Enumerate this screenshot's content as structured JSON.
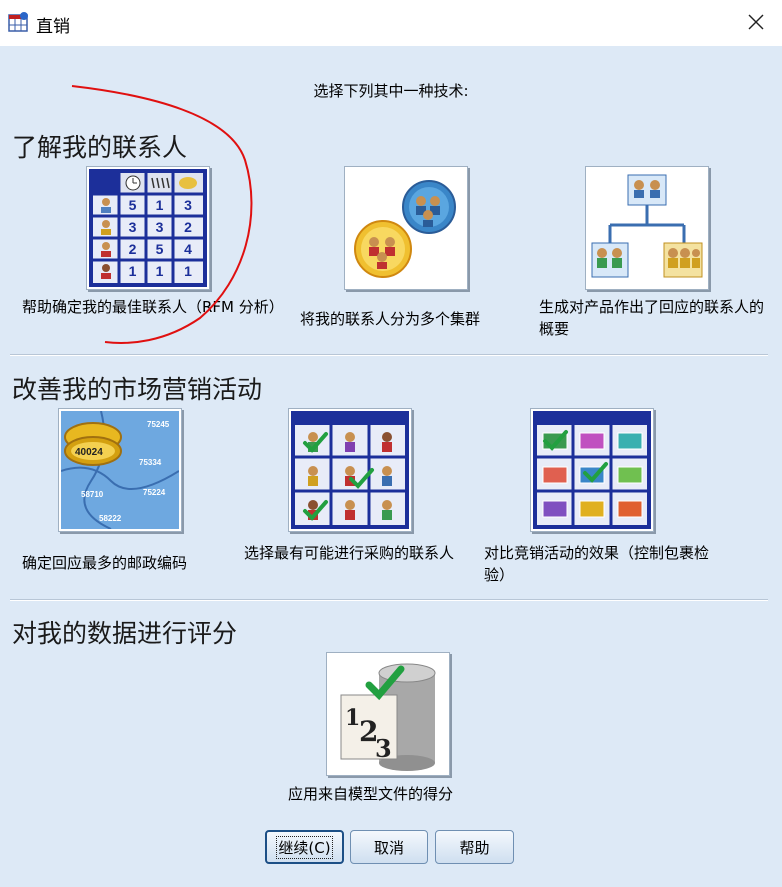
{
  "window": {
    "title": "直销",
    "app_icon": "spss-grid-icon",
    "close_icon": "close-icon"
  },
  "prompt": "选择下列其中一种技术:",
  "sections": [
    {
      "title": "了解我的联系人",
      "options": [
        {
          "label": "帮助确定我的最佳联系人（RFM 分析）",
          "icon": "rfm-table-icon",
          "table": [
            [
              "5",
              "1",
              "3"
            ],
            [
              "3",
              "3",
              "2"
            ],
            [
              "2",
              "5",
              "4"
            ],
            [
              "1",
              "1",
              "1"
            ]
          ]
        },
        {
          "label": "将我的联系人分为多个集群",
          "icon": "contact-clusters-icon"
        },
        {
          "label": "生成对产品作出了回应的联系人的概要",
          "icon": "contact-hierarchy-icon"
        }
      ]
    },
    {
      "title": "改善我的市场营销活动",
      "options": [
        {
          "label": "确定回应最多的邮政编码",
          "icon": "postal-code-map-icon",
          "codes": [
            "75245",
            "40024",
            "75334",
            "58710",
            "75224",
            "58222"
          ]
        },
        {
          "label": "选择最有可能进行采购的联系人",
          "icon": "select-contacts-grid-icon"
        },
        {
          "label": "对比竞销活动的效果（控制包裹检验）",
          "icon": "campaign-envelopes-icon"
        }
      ]
    },
    {
      "title": "对我的数据进行评分",
      "options": [
        {
          "label": "应用来自模型文件的得分",
          "icon": "score-model-icon"
        }
      ]
    }
  ],
  "buttons": {
    "continue": "继续(C)",
    "cancel": "取消",
    "help": "帮助"
  },
  "colors": {
    "dialog_background": "#dde9f6",
    "accent_blue": "#1f3a93",
    "annotation_red": "#e01010"
  }
}
